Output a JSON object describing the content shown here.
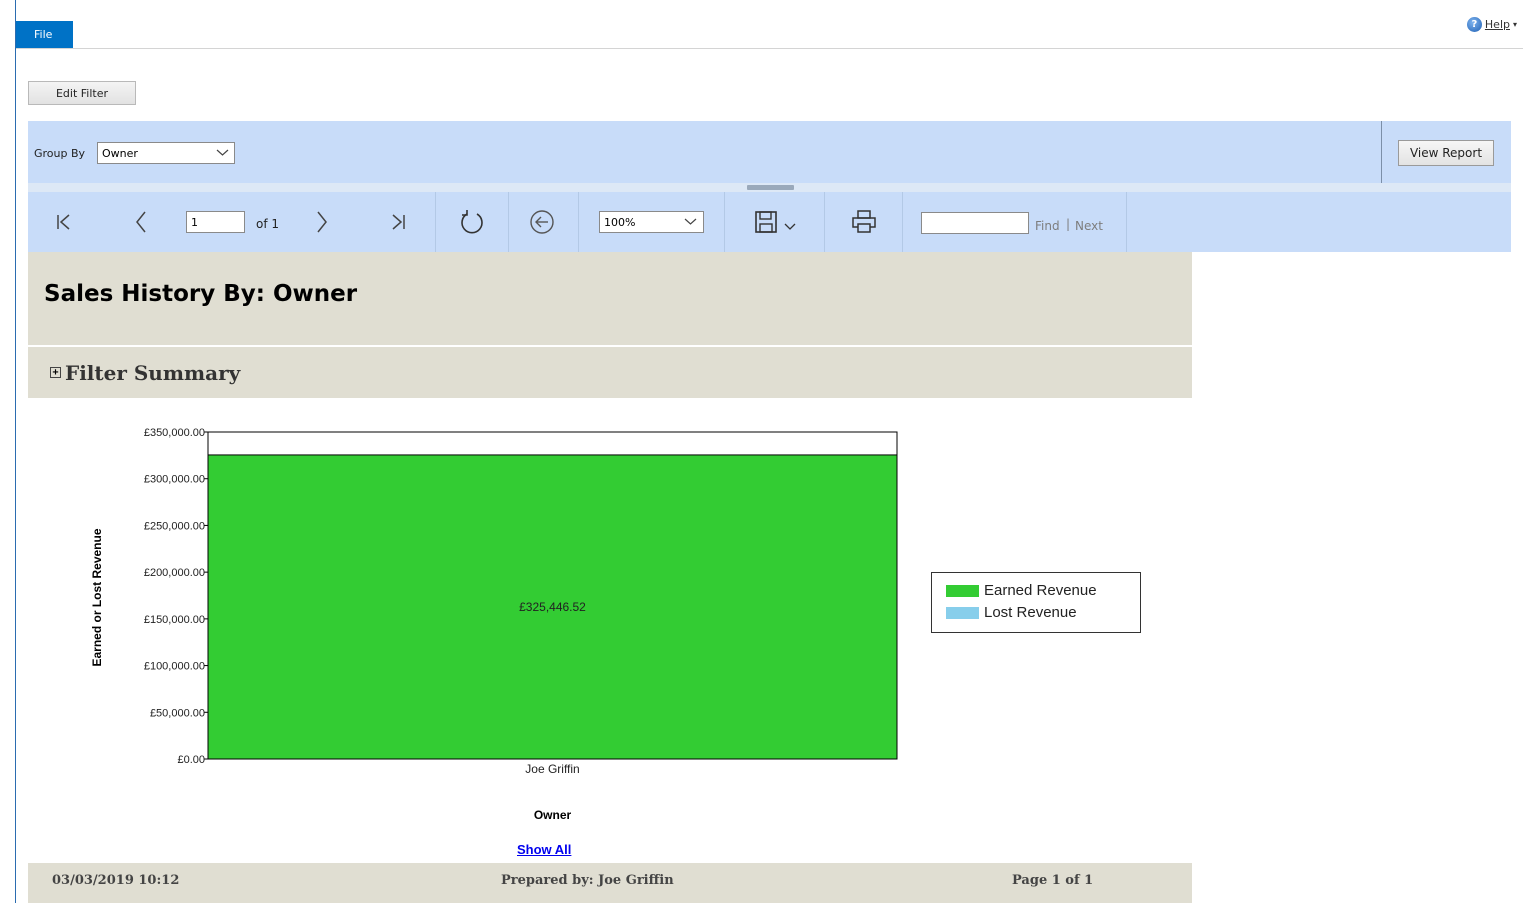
{
  "ribbon": {
    "file_tab": "File",
    "help_label": "Help",
    "help_chevron": "▾"
  },
  "filter": {
    "edit_filter_label": "Edit Filter"
  },
  "params": {
    "group_by_label": "Group By",
    "group_by_value": "Owner",
    "view_report_label": "View Report"
  },
  "toolbar": {
    "page_value": "1",
    "of_label": "of 1",
    "zoom_value": "100%",
    "find_label": "Find",
    "separator": "|",
    "next_label": "Next"
  },
  "report": {
    "title": "Sales History By: Owner",
    "filter_summary_label": "Filter Summary",
    "expand_symbol": "+",
    "show_all_label": "Show All"
  },
  "footer": {
    "timestamp": "03/03/2019 10:12",
    "prepared_by": "Prepared by:  Joe Griffin",
    "page_info": "Page 1 of 1"
  },
  "colors": {
    "earned": "#33cc33",
    "lost": "#87ceeb",
    "toolbar_bg": "#c8dcf9",
    "report_band": "#e0ded2",
    "file_tab": "#0072c6"
  },
  "chart_data": {
    "type": "bar",
    "categories": [
      "Joe Griffin"
    ],
    "series": [
      {
        "name": "Earned Revenue",
        "values": [
          325446.52
        ]
      },
      {
        "name": "Lost Revenue",
        "values": [
          0
        ]
      }
    ],
    "data_labels": [
      "£325,446.52"
    ],
    "xlabel": "Owner",
    "ylabel": "Earned or Lost Revenue",
    "ylim": [
      0,
      350000
    ],
    "yticks": [
      "£0.00",
      "£50,000.00",
      "£100,000.00",
      "£150,000.00",
      "£200,000.00",
      "£250,000.00",
      "£300,000.00",
      "£350,000.00"
    ],
    "legend_position": "right",
    "grid": false
  }
}
